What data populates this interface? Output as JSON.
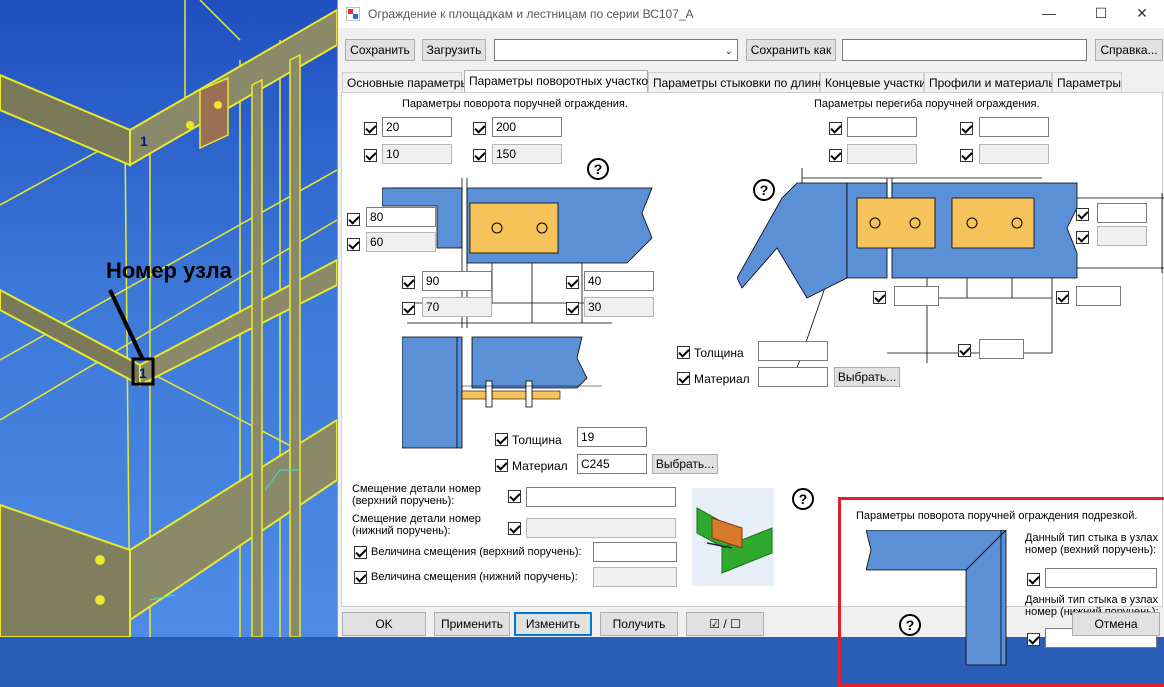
{
  "window": {
    "title": "Ограждение к площадкам и лестницам по серии ВС107_А",
    "minimize": "—",
    "maximize": "☐",
    "close": "✕"
  },
  "toolbar": {
    "save": "Сохранить",
    "load": "Загрузить",
    "save_as": "Сохранить как",
    "help": "Справка...",
    "combo_value": "",
    "save_as_field": ""
  },
  "tabs": [
    {
      "label": "Основные параметры"
    },
    {
      "label": "Параметры поворотных участков"
    },
    {
      "label": "Параметры стыковки по длине"
    },
    {
      "label": "Концевые участки"
    },
    {
      "label": "Профили и материалы"
    },
    {
      "label": "Параметры"
    }
  ],
  "viewport": {
    "node_label": "Номер узла",
    "node_number": "1"
  },
  "rotation": {
    "title": "Параметры   поворота   поручней  ограждения.",
    "top_left_1": "20",
    "top_left_2": "10",
    "top_right_1": "200",
    "top_right_2": "150",
    "side_1": "80",
    "side_2": "60",
    "bottom_left_1": "90",
    "bottom_left_2": "70",
    "bottom_right_1": "40",
    "bottom_right_2": "30",
    "thickness_label": "Толщина",
    "thickness_value": "19",
    "material_label": "Материал",
    "material_value": "C245",
    "choose": "Выбрать..."
  },
  "bend": {
    "title": "Параметры   перегиба   поручней   ограждения.",
    "thickness_label": "Толщина",
    "material_label": "Материал",
    "choose": "Выбрать..."
  },
  "offsets": {
    "top_label_1": "Смещение  детали  номер",
    "top_label_2": "(верхний  поручень):",
    "bottom_label_1": "Смещение  детали  номер",
    "bottom_label_2": "(нижний  поручень):",
    "top_value_label": "Величина смещения (верхний поручень):",
    "bottom_value_label": "Величина смещения (нижний поручень):"
  },
  "cut": {
    "title": "Параметры  поворота  поручней  ограждения  подрезкой.",
    "top_label_1": "Данный тип стыка в узлах",
    "top_label_2": "номер (вехний поручень):",
    "bottom_label_1": "Данный тип стыка в узлах",
    "bottom_label_2": "номер (нижний поручень):"
  },
  "footer": {
    "ok": "OK",
    "apply": "Применить",
    "change": "Изменить",
    "get": "Получить",
    "toggle": "☑ / ☐",
    "cancel": "Отмена"
  },
  "help_mark": "?",
  "colors": {
    "steel_blue": "#5b8fd6",
    "plate_orange": "#f6c35a",
    "highlight_red": "#e0202a",
    "accent": "#0078d7"
  }
}
